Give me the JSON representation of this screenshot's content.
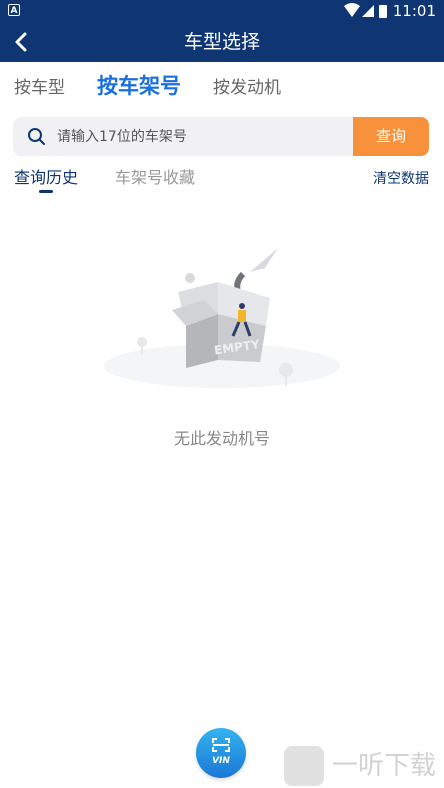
{
  "status_bar": {
    "time": "11:01",
    "notification_badge": "A"
  },
  "app_bar": {
    "title": "车型选择"
  },
  "tabs": [
    {
      "label": "按车型",
      "active": false
    },
    {
      "label": "按车架号",
      "active": true
    },
    {
      "label": "按发动机",
      "active": false
    }
  ],
  "search": {
    "placeholder": "请输入17位的车架号",
    "value": "",
    "button_label": "查询"
  },
  "sub_tabs": {
    "history": "查询历史",
    "favorites": "车架号收藏",
    "clear": "清空数据"
  },
  "empty_state": {
    "box_text": "EMPTY",
    "message": "无此发动机号"
  },
  "vin_button": {
    "label": "VIN"
  },
  "watermark": {
    "text": "一听下载"
  },
  "colors": {
    "header": "#0f3572",
    "accent": "#1a6fe0",
    "search_button": "#f7913b"
  }
}
